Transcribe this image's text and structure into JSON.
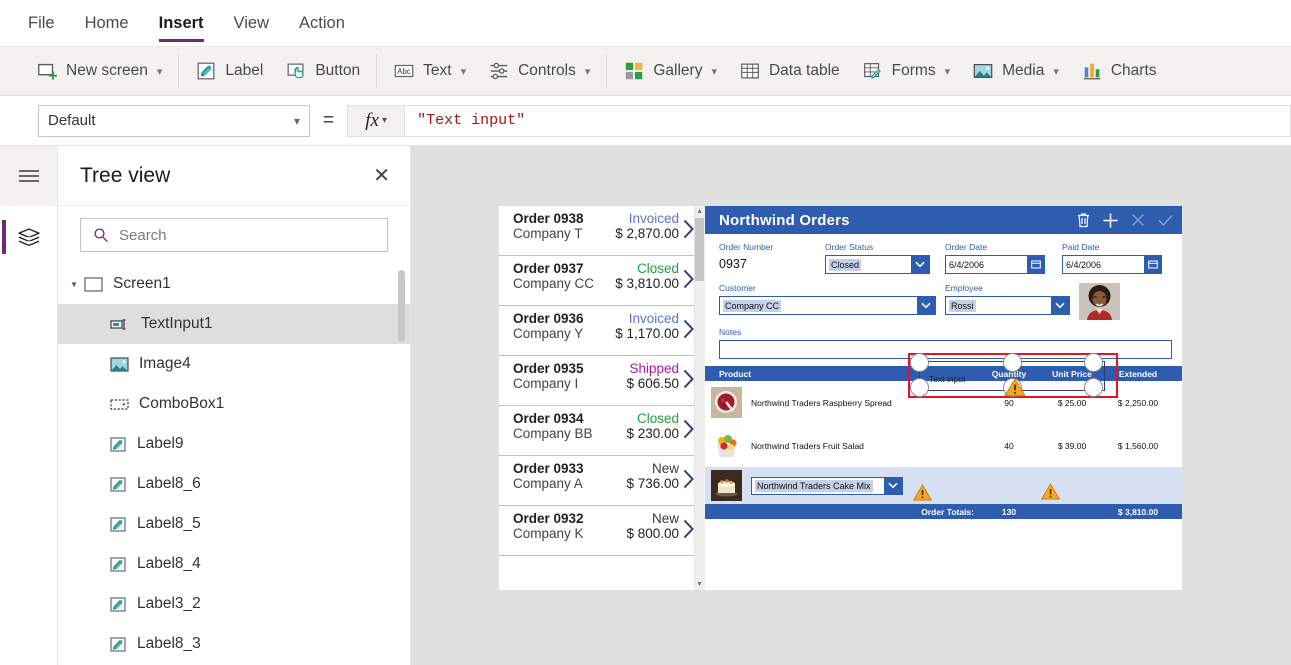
{
  "menu": {
    "items": [
      {
        "label": "File",
        "active": false
      },
      {
        "label": "Home",
        "active": false
      },
      {
        "label": "Insert",
        "active": true
      },
      {
        "label": "View",
        "active": false
      },
      {
        "label": "Action",
        "active": false
      }
    ]
  },
  "ribbon": {
    "items": [
      {
        "label": "New screen",
        "icon": "new-screen-icon",
        "caret": true,
        "sep_after": true
      },
      {
        "label": "Label",
        "icon": "label-icon",
        "caret": false,
        "sep_after": false
      },
      {
        "label": "Button",
        "icon": "button-icon",
        "caret": false,
        "sep_after": true
      },
      {
        "label": "Text",
        "icon": "text-icon",
        "caret": true,
        "sep_after": false
      },
      {
        "label": "Controls",
        "icon": "controls-icon",
        "caret": true,
        "sep_after": true
      },
      {
        "label": "Gallery",
        "icon": "gallery-icon",
        "caret": true,
        "sep_after": false
      },
      {
        "label": "Data table",
        "icon": "data-table-icon",
        "caret": false,
        "sep_after": false
      },
      {
        "label": "Forms",
        "icon": "forms-icon",
        "caret": true,
        "sep_after": false
      },
      {
        "label": "Media",
        "icon": "media-icon",
        "caret": true,
        "sep_after": false
      },
      {
        "label": "Charts",
        "icon": "charts-icon",
        "caret": false,
        "sep_after": false
      }
    ]
  },
  "formula_bar": {
    "property": "Default",
    "equals": "=",
    "fx_label": "fx",
    "formula": "\"Text input\""
  },
  "tree_panel": {
    "title": "Tree view",
    "close_label": "✕",
    "search_placeholder": "Search",
    "search_value": "",
    "items": [
      {
        "label": "Screen1",
        "icon": "screen-icon",
        "depth": 1,
        "selected": false,
        "expanded": true
      },
      {
        "label": "TextInput1",
        "icon": "textinput-icon",
        "depth": 2,
        "selected": true,
        "expanded": false
      },
      {
        "label": "Image4",
        "icon": "image-icon",
        "depth": 2,
        "selected": false,
        "expanded": false
      },
      {
        "label": "ComboBox1",
        "icon": "combobox-icon",
        "depth": 2,
        "selected": false,
        "expanded": false
      },
      {
        "label": "Label9",
        "icon": "label-icon",
        "depth": 2,
        "selected": false,
        "expanded": false
      },
      {
        "label": "Label8_6",
        "icon": "label-icon",
        "depth": 2,
        "selected": false,
        "expanded": false
      },
      {
        "label": "Label8_5",
        "icon": "label-icon",
        "depth": 2,
        "selected": false,
        "expanded": false
      },
      {
        "label": "Label8_4",
        "icon": "label-icon",
        "depth": 2,
        "selected": false,
        "expanded": false
      },
      {
        "label": "Label3_2",
        "icon": "label-icon",
        "depth": 2,
        "selected": false,
        "expanded": false
      },
      {
        "label": "Label8_3",
        "icon": "label-icon",
        "depth": 2,
        "selected": false,
        "expanded": false
      }
    ]
  },
  "canvas": {
    "selection": {
      "control_label": "Text input",
      "control_name": "TextInput1"
    },
    "gallery": {
      "items": [
        {
          "order": "Order 0938",
          "company": "Company T",
          "status": "Invoiced",
          "amount": "$ 2,870.00"
        },
        {
          "order": "Order 0937",
          "company": "Company CC",
          "status": "Closed",
          "amount": "$ 3,810.00"
        },
        {
          "order": "Order 0936",
          "company": "Company Y",
          "status": "Invoiced",
          "amount": "$ 1,170.00"
        },
        {
          "order": "Order 0935",
          "company": "Company I",
          "status": "Shipped",
          "amount": "$ 606.50"
        },
        {
          "order": "Order 0934",
          "company": "Company BB",
          "status": "Closed",
          "amount": "$ 230.00"
        },
        {
          "order": "Order 0933",
          "company": "Company A",
          "status": "New",
          "amount": "$ 736.00"
        },
        {
          "order": "Order 0932",
          "company": "Company K",
          "status": "New",
          "amount": "$ 800.00"
        }
      ]
    },
    "form": {
      "title": "Northwind Orders",
      "tools": [
        {
          "name": "delete-icon",
          "enabled": true
        },
        {
          "name": "add-icon",
          "enabled": true
        },
        {
          "name": "cancel-icon",
          "enabled": false
        },
        {
          "name": "confirm-icon",
          "enabled": false
        }
      ],
      "fields": {
        "order_number_label": "Order Number",
        "order_number_value": "0937",
        "order_status_label": "Order Status",
        "order_status_value": "Closed",
        "order_date_label": "Order Date",
        "order_date_value": "6/4/2006",
        "paid_date_label": "Paid Date",
        "paid_date_value": "6/4/2006",
        "customer_label": "Customer",
        "customer_value": "Company CC",
        "employee_label": "Employee",
        "employee_value": "Rossi",
        "notes_label": "Notes",
        "notes_value": ""
      },
      "products": {
        "headers": [
          "Product",
          "Quantity",
          "Unit Price",
          "Extended"
        ],
        "rows": [
          {
            "product": "Northwind Traders Raspberry Spread",
            "quantity": "90",
            "unit_price": "$ 25.00",
            "extended": "$ 2,250.00",
            "thumb": "raspberry-spread-thumb"
          },
          {
            "product": "Northwind Traders Fruit Salad",
            "quantity": "40",
            "unit_price": "$ 39.00",
            "extended": "$ 1,560.00",
            "thumb": "fruit-salad-thumb"
          }
        ],
        "new_row": {
          "product": "Northwind Traders Cake Mix",
          "thumb": "cake-mix-thumb",
          "quantity_warning": true,
          "price_warning": true
        },
        "totals_label": "Order Totals:",
        "totals_quantity": "130",
        "totals_extended": "$ 3,810.00"
      }
    }
  },
  "colors": {
    "accent_purple": "#742774",
    "form_blue": "#2e5caf",
    "selection_red": "#e81123",
    "formula_text": "#a31515",
    "status_invoiced": "#6271c8",
    "status_closed": "#21a03d",
    "status_shipped": "#b4179b",
    "status_new": "#3b3b3b"
  }
}
